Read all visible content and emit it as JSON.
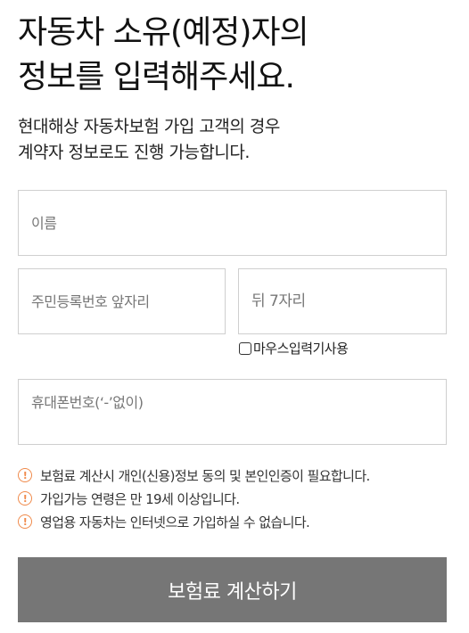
{
  "header": {
    "title_line1": "자동차 소유(예정)자의",
    "title_line2": "정보를 입력해주세요.",
    "subtitle_line1": "현대해상 자동차보험 가입 고객의 경우",
    "subtitle_line2": "계약자 정보로도 진행 가능합니다."
  },
  "form": {
    "name_placeholder": "이름",
    "rrn_front_placeholder": "주민등록번호 앞자리",
    "rrn_back_placeholder": "뒤 7자리",
    "mouse_input_label": "마우스입력기사용",
    "phone_placeholder": "휴대폰번호(‘-’없이)"
  },
  "notices": [
    "보험료 계산시 개인(신용)정보 동의 및 본인인증이 필요합니다.",
    "가입가능 연령은 만 19세 이상입니다.",
    "영업용 자동차는 인터넷으로 가입하실 수 없습니다."
  ],
  "notice_icon": "warning-circle-icon",
  "colors": {
    "accent_warning": "#f08a4b",
    "button_bg": "#767676",
    "border": "#cfcfcf"
  },
  "actions": {
    "calculate_label": "보험료 계산하기"
  }
}
